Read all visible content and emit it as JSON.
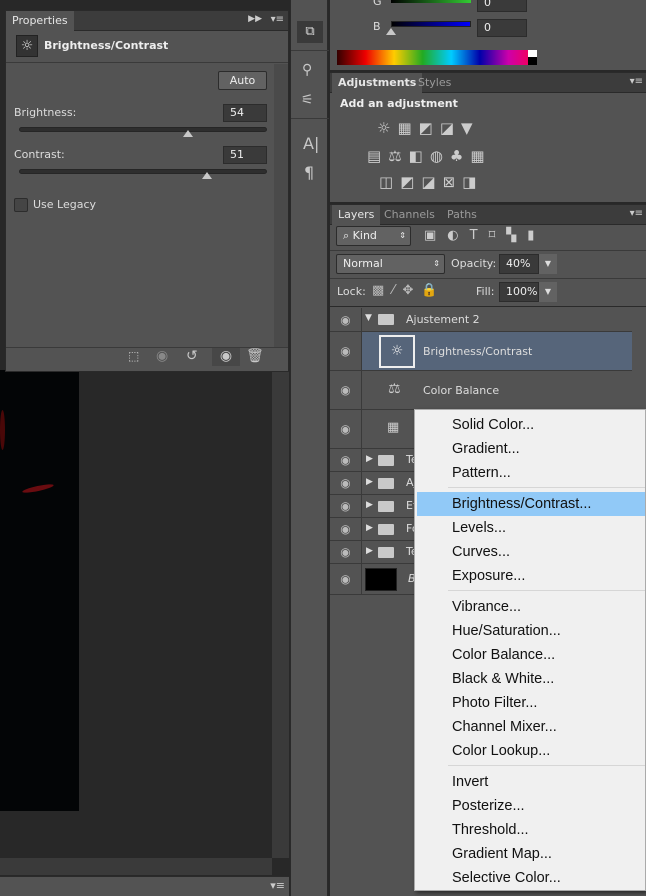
{
  "properties": {
    "tab": "Properties",
    "title": "Brightness/Contrast",
    "auto": "Auto",
    "brightness_label": "Brightness:",
    "brightness_value": "54",
    "contrast_label": "Contrast:",
    "contrast_value": "51",
    "brightness_fraction": 0.68,
    "contrast_fraction": 0.76,
    "use_legacy": "Use Legacy",
    "use_legacy_checked": false
  },
  "color": {
    "g_label": "G",
    "g_value": "0",
    "b_label": "B",
    "b_value": "0"
  },
  "adjustments": {
    "tabs": [
      "Adjustments",
      "Styles"
    ],
    "heading": "Add an adjustment"
  },
  "layers": {
    "tabs": [
      "Layers",
      "Channels",
      "Paths"
    ],
    "filter": "Kind",
    "blend_mode": "Normal",
    "opacity_label": "Opacity:",
    "opacity": "40%",
    "lock_label": "Lock:",
    "fill_label": "Fill:",
    "fill": "100%",
    "rows": [
      {
        "name": "Ajustement 2"
      },
      {
        "name": "Brightness/Contrast"
      },
      {
        "name": "Color Balance"
      },
      {
        "name": ""
      },
      {
        "name": "Te"
      },
      {
        "name": "Aj"
      },
      {
        "name": "Et"
      },
      {
        "name": "Fo"
      },
      {
        "name": "Te"
      },
      {
        "name": "B"
      }
    ]
  },
  "menu": {
    "items": [
      "Solid Color...",
      "Gradient...",
      "Pattern...",
      "Brightness/Contrast...",
      "Levels...",
      "Curves...",
      "Exposure...",
      "Vibrance...",
      "Hue/Saturation...",
      "Color Balance...",
      "Black & White...",
      "Photo Filter...",
      "Channel Mixer...",
      "Color Lookup...",
      "Invert",
      "Posterize...",
      "Threshold...",
      "Gradient Map...",
      "Selective Color..."
    ],
    "highlighted": "Brightness/Contrast..."
  },
  "colors": {
    "panel": "#535353",
    "selected_layer": "#56657a",
    "menu_highlight": "#91c9f7"
  }
}
